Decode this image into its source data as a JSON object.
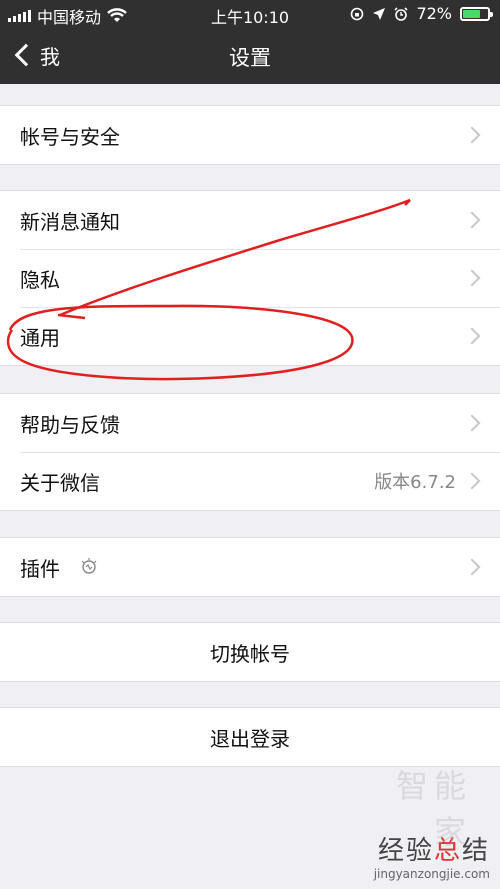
{
  "status_bar": {
    "carrier": "中国移动",
    "time": "上午10:10",
    "battery": "72%",
    "battery_level": 0.72,
    "icons": [
      "signal-icon",
      "wifi-icon",
      "rotation-lock-icon",
      "location-icon",
      "alarm-icon",
      "battery-icon"
    ]
  },
  "nav": {
    "back_label": "我",
    "title": "设置"
  },
  "groups": {
    "account": {
      "account_security": "帐号与安全"
    },
    "general": {
      "notifications": "新消息通知",
      "privacy": "隐私",
      "general": "通用"
    },
    "about": {
      "help_feedback": "帮助与反馈",
      "about_wechat": "关于微信",
      "version": "版本6.7.2"
    },
    "plugins": {
      "plugins": "插件",
      "icon": "lightbulb-icon"
    },
    "switch_account": "切换帐号",
    "logout": "退出登录"
  },
  "watermark": {
    "text_main": "经验总结",
    "text_red": "总",
    "url": "jingyanzongjie.com",
    "ghost": "智能家"
  },
  "colors": {
    "nav_bg": "#303030",
    "page_bg": "#efeff4",
    "annotation": "#e02020",
    "battery": "#4cd964"
  }
}
